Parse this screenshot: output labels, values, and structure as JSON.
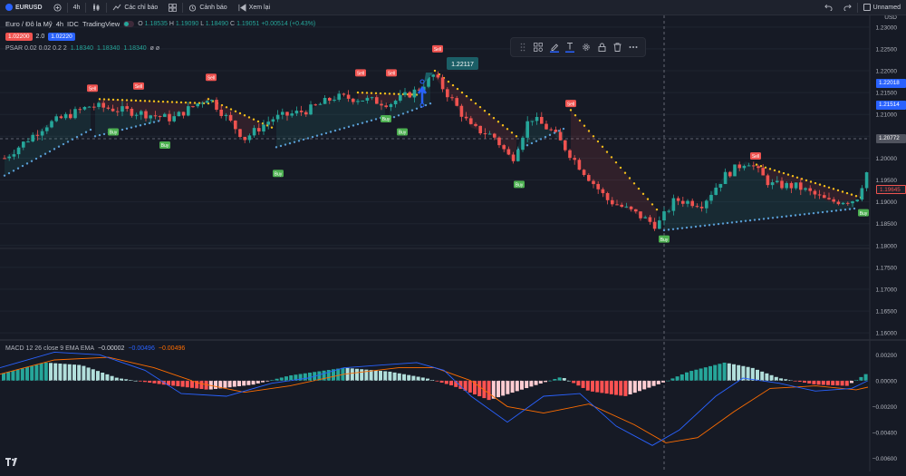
{
  "topbar": {
    "symbol": "EURUSD",
    "interval": "4h",
    "indicators_label": "Các chỉ báo",
    "alerts_label": "Cảnh báo",
    "replay_label": "Xem lại",
    "layout_name": "Unnamed"
  },
  "legend": {
    "title": "Euro / Đô la Mỹ",
    "interval": "4h",
    "exchange": "IDC",
    "source": "TradingView",
    "open_k": "O",
    "open": "1.18535",
    "high_k": "H",
    "high": "1.19090",
    "low_k": "L",
    "low": "1.18490",
    "close_k": "C",
    "close": "1.19051",
    "change": "+0.00514 (+0.43%)",
    "sell_price": "1.02200",
    "spread": "2.0",
    "buy_price": "1.02220",
    "psar_label": "PSAR 0.02 0.02 0.2 2",
    "psar_v1": "1.18340",
    "psar_v2": "1.18340",
    "psar_v3": "1.18340",
    "psar_v4": "ø ø"
  },
  "macd_legend": {
    "label": "MACD 12 26 close 9 EMA EMA",
    "v1": "−0.00002",
    "v2": "−0.00496",
    "v3": "−0.00496"
  },
  "price_axis": {
    "currency": "USD",
    "ticks": [
      "1.23000",
      "1.22500",
      "1.22000",
      "1.21500",
      "1.21000",
      "1.20500",
      "1.20000",
      "1.19500",
      "1.19000",
      "1.18500",
      "1.18000",
      "1.17500",
      "1.17000",
      "1.16500",
      "1.16000"
    ],
    "tag_blue_1": "1.22018",
    "tag_blue_2": "1.21514",
    "tag_cross": "1.20772",
    "tag_last": "1.19645"
  },
  "macd_axis": {
    "ticks": [
      "0.00200",
      "0.00000",
      "−0.00200",
      "−0.00400",
      "−0.00600"
    ]
  },
  "callout": "1.22117",
  "signals": {
    "buy": "Buy",
    "sell": "Sell"
  },
  "colors": {
    "up": "#26a69a",
    "down": "#ef5350",
    "sar_up": "#5b9bd5",
    "sar_down": "#f5c518",
    "macd_line": "#2962ff",
    "signal_line": "#ff6d00",
    "hist_pos_strong": "#26a69a",
    "hist_pos_weak": "#b2dfdb",
    "hist_neg_strong": "#ff5252",
    "hist_neg_weak": "#ffcdd2",
    "axis_blue": "#2962ff"
  }
}
